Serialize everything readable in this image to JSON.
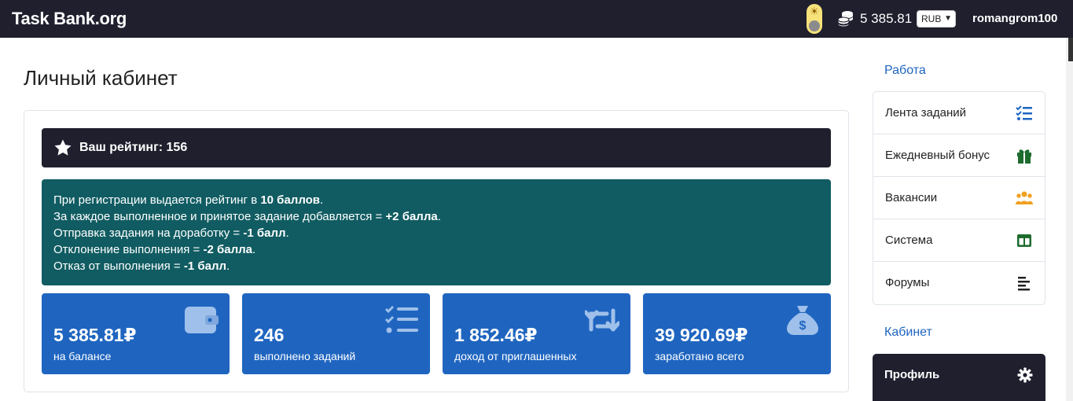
{
  "navbar": {
    "brand": "Task Bank.org",
    "theme_icon": "sun-icon",
    "balance_icon": "coins-icon",
    "balance": "5 385.81",
    "currency": "RUB",
    "username": "romangrom100"
  },
  "main": {
    "title": "Личный кабинет",
    "rating": {
      "icon": "star-icon",
      "label": "Ваш рейтинг:",
      "value": "156"
    },
    "info_lines": [
      {
        "pre": "При регистрации выдается рейтинг в ",
        "bold": "10 баллов",
        "post": "."
      },
      {
        "pre": "За каждое выполненное и принятое задание добавляется = ",
        "bold": "+2 балла",
        "post": "."
      },
      {
        "pre": "Отправка задания на доработку = ",
        "bold": "-1 балл",
        "post": "."
      },
      {
        "pre": "Отклонение выполнения = ",
        "bold": "-2 балла",
        "post": "."
      },
      {
        "pre": "Отказ от выполнения = ",
        "bold": "-1 балл",
        "post": "."
      }
    ],
    "stats": [
      {
        "value": "5 385.81₽",
        "label": "на балансе",
        "icon": "wallet-icon"
      },
      {
        "value": "246",
        "label": "выполнено заданий",
        "icon": "checklist-icon"
      },
      {
        "value": "1 852.46₽",
        "label": "доход от приглашенных",
        "icon": "repeat-icon"
      },
      {
        "value": "39 920.69₽",
        "label": "заработано всего",
        "icon": "money-bag-icon"
      }
    ]
  },
  "sidebar": {
    "work_heading": "Работа",
    "work_items": [
      {
        "label": "Лента заданий",
        "icon": "task-list-icon",
        "color": "#1f65c0"
      },
      {
        "label": "Ежедневный бонус",
        "icon": "gift-icon",
        "color": "#1e6b2e"
      },
      {
        "label": "Вакансии",
        "icon": "users-icon",
        "color": "#f0a020"
      },
      {
        "label": "Система",
        "icon": "columns-icon",
        "color": "#1e6b2e"
      },
      {
        "label": "Форумы",
        "icon": "align-left-icon",
        "color": "#222222"
      }
    ],
    "cabinet_heading": "Кабинет",
    "cabinet_items": [
      {
        "label": "Профиль",
        "icon": "gear-icon"
      }
    ]
  },
  "colors": {
    "navbar": "#1f1f2e",
    "info_box": "#105c62",
    "stat_card": "#1f65c0",
    "accent": "#1f65c0"
  }
}
